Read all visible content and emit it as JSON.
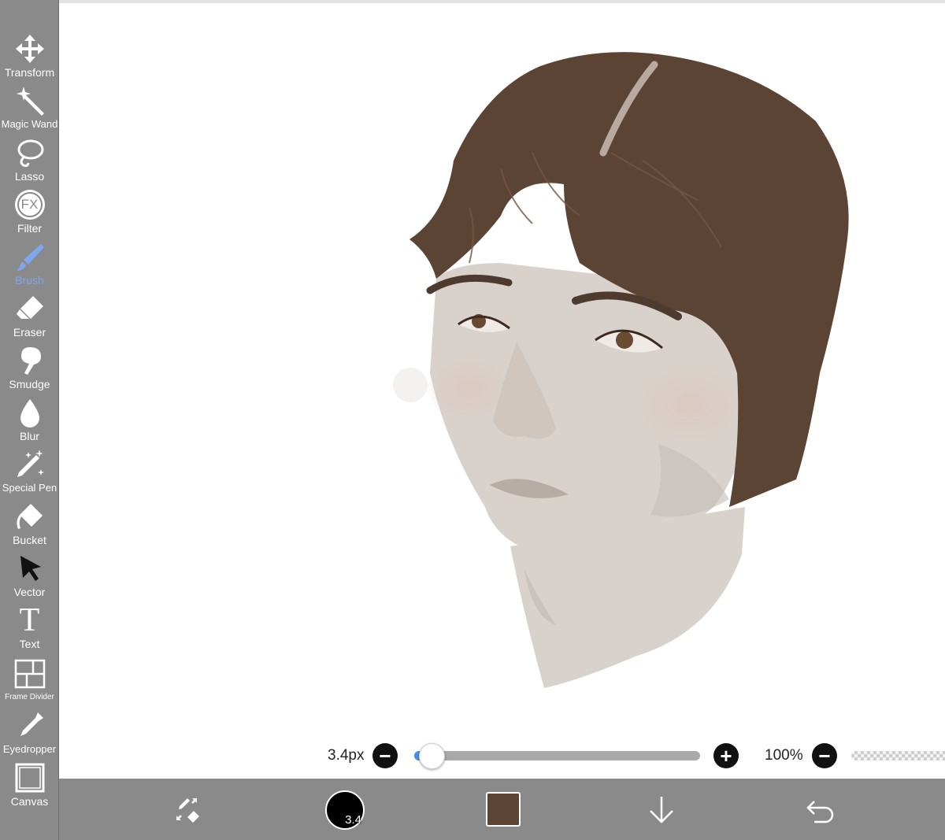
{
  "toolbar": {
    "transform": "Transform",
    "magic_wand": "Magic Wand",
    "lasso": "Lasso",
    "filter": "Filter",
    "filter_icon_text": "FX",
    "brush": "Brush",
    "eraser": "Eraser",
    "smudge": "Smudge",
    "blur": "Blur",
    "special_pen": "Special Pen",
    "bucket": "Bucket",
    "vector": "Vector",
    "text": "Text",
    "text_icon_glyph": "T",
    "frame_divider": "Frame Divider",
    "eyedropper": "Eyedropper",
    "canvas": "Canvas",
    "active_tool": "Brush",
    "active_color": "#7ea7f0"
  },
  "brush_controls": {
    "size_label": "3.4px",
    "size_fraction": 0.04,
    "opacity_label": "100%",
    "minus_glyph": "−",
    "plus_glyph": "+"
  },
  "bottombar": {
    "brush_size_badge": "3.4",
    "current_color": "#5c4434",
    "icons": [
      "swap-brush-eraser-icon",
      "brush-preview",
      "color-swatch",
      "down-arrow-icon",
      "undo-icon"
    ]
  },
  "colors": {
    "toolbar_bg": "#8a8a8a",
    "hair": "#5c4434",
    "skin": "#d9d2cc"
  }
}
